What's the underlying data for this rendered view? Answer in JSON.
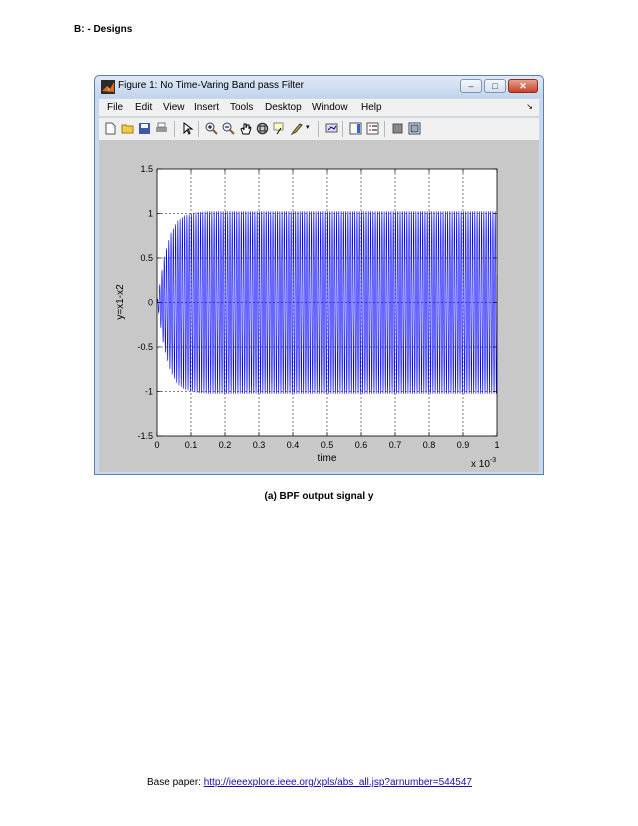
{
  "document": {
    "heading": "B: - Designs",
    "caption": "(a) BPF output signal y",
    "footer_label": "Base paper: ",
    "footer_link": "http://ieeexplore.ieee.org/xpls/abs_all.jsp?arnumber=544547"
  },
  "window": {
    "title": "Figure 1: No Time-Varing Band pass Filter",
    "controls": {
      "minimize": "–",
      "maximize": "□",
      "close": "✕"
    }
  },
  "menu": [
    "File",
    "Edit",
    "View",
    "Insert",
    "Tools",
    "Desktop",
    "Window",
    "Help"
  ],
  "toolbar_icons": [
    "new-figure-icon",
    "open-file-icon",
    "save-icon",
    "print-icon",
    "edit-plot-icon",
    "zoom-in-icon",
    "zoom-out-icon",
    "pan-icon",
    "rotate-3d-icon",
    "data-cursor-icon",
    "brush-icon",
    "link-plot-icon",
    "colorbar-icon",
    "legend-icon",
    "hide-plot-tools-icon",
    "show-plot-tools-icon"
  ],
  "chart_data": {
    "type": "line",
    "xlabel": "time",
    "ylabel": "y=x1-x2",
    "x_multiplier": "x 10",
    "x_multiplier_exp": "-3",
    "xlim": [
      0,
      1
    ],
    "ylim": [
      -1.5,
      1.5
    ],
    "x_ticks": [
      "0",
      "0.1",
      "0.2",
      "0.3",
      "0.4",
      "0.5",
      "0.6",
      "0.7",
      "0.8",
      "0.9",
      "1"
    ],
    "y_ticks": [
      "1.5",
      "1",
      "0.5",
      "0",
      "-0.5",
      "-1",
      "-1.5"
    ],
    "grid": true,
    "series": [
      {
        "color": "#0000ff",
        "description_of_envelope": null,
        "x": [
          0,
          0.02,
          0.04,
          0.06,
          0.08,
          0.1,
          0.12,
          0.15,
          0.2,
          1.0
        ],
        "envelope": [
          0,
          0.5,
          0.78,
          0.92,
          0.98,
          1.0,
          1.02,
          1.03,
          1.03,
          1.03
        ]
      }
    ]
  }
}
